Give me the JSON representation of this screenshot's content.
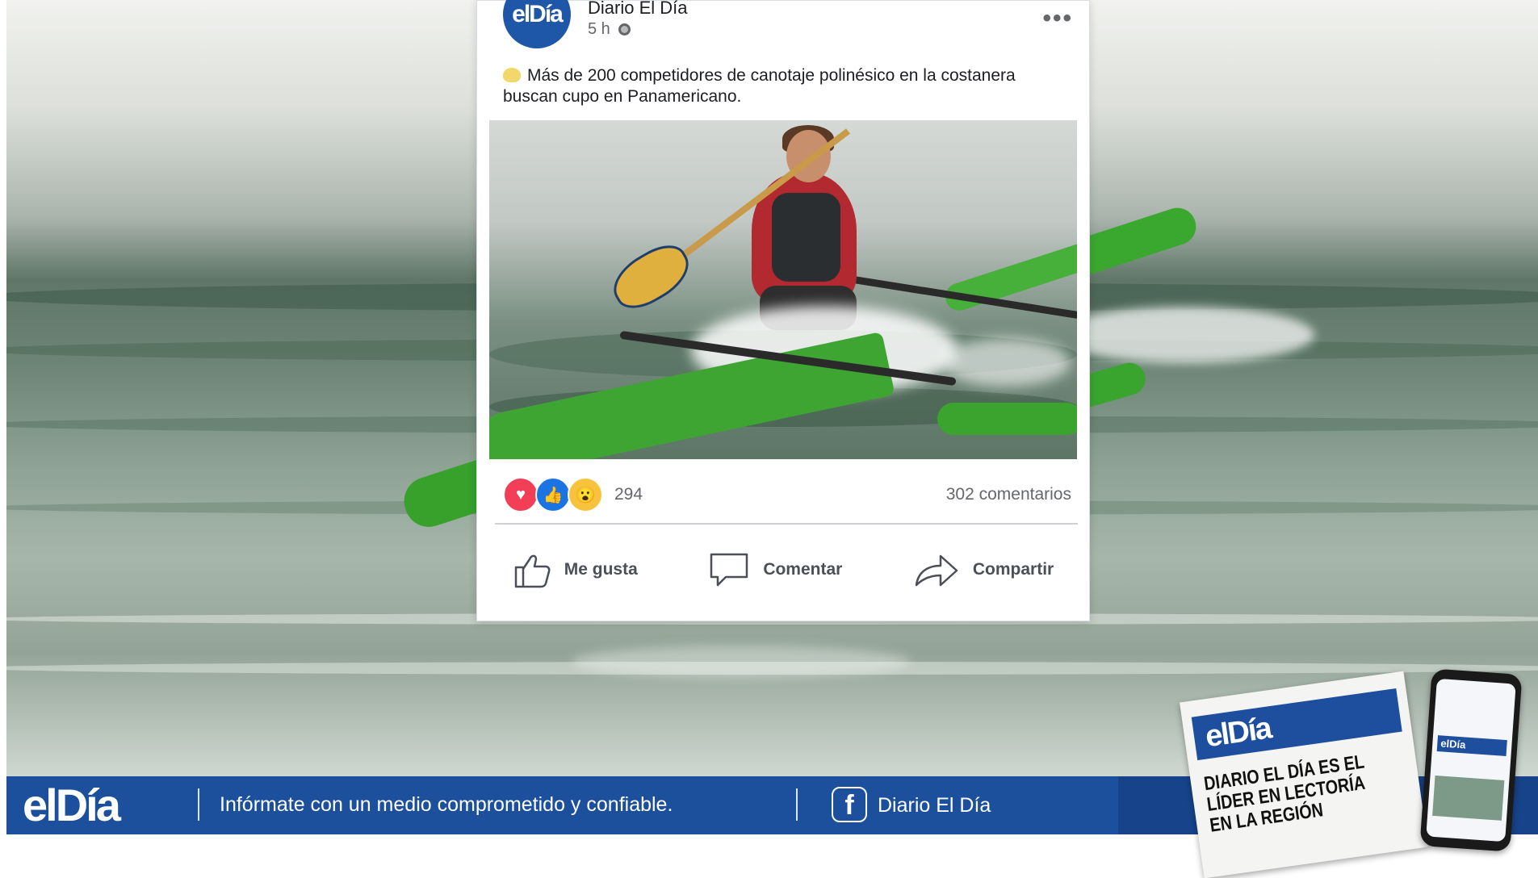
{
  "post": {
    "page_name": "Diario El Día",
    "avatar_text": "elDía",
    "time": "5 h",
    "more_label": "•••",
    "text": "Más de 200 competidores de canotaje polinésico en la costanera buscan cupo en Panamericano.",
    "reaction_count": "294",
    "comments_label": "302 comentarios",
    "actions": {
      "like": "Me gusta",
      "comment": "Comentar",
      "share": "Compartir"
    }
  },
  "banner": {
    "logo": "elDía",
    "tagline": "Infórmate con un medio comprometido y confiable.",
    "facebook_label": "Diario El Día"
  },
  "newspaper": {
    "masthead": "elDía",
    "headline": "DIARIO EL DÍA ES EL LÍDER EN LECTORÍA EN LA REGIÓN"
  },
  "phone": {
    "masthead": "elDía"
  },
  "colors": {
    "brand_blue": "#1c4f9c",
    "facebook_like_blue": "#1b74e4",
    "love_red": "#f33e58",
    "wow_yellow": "#f7c33c"
  },
  "icons": [
    "globe-icon",
    "more-icon",
    "love-reaction-icon",
    "like-reaction-icon",
    "wow-reaction-icon",
    "thumbs-up-icon",
    "comment-icon",
    "share-icon",
    "facebook-icon"
  ]
}
